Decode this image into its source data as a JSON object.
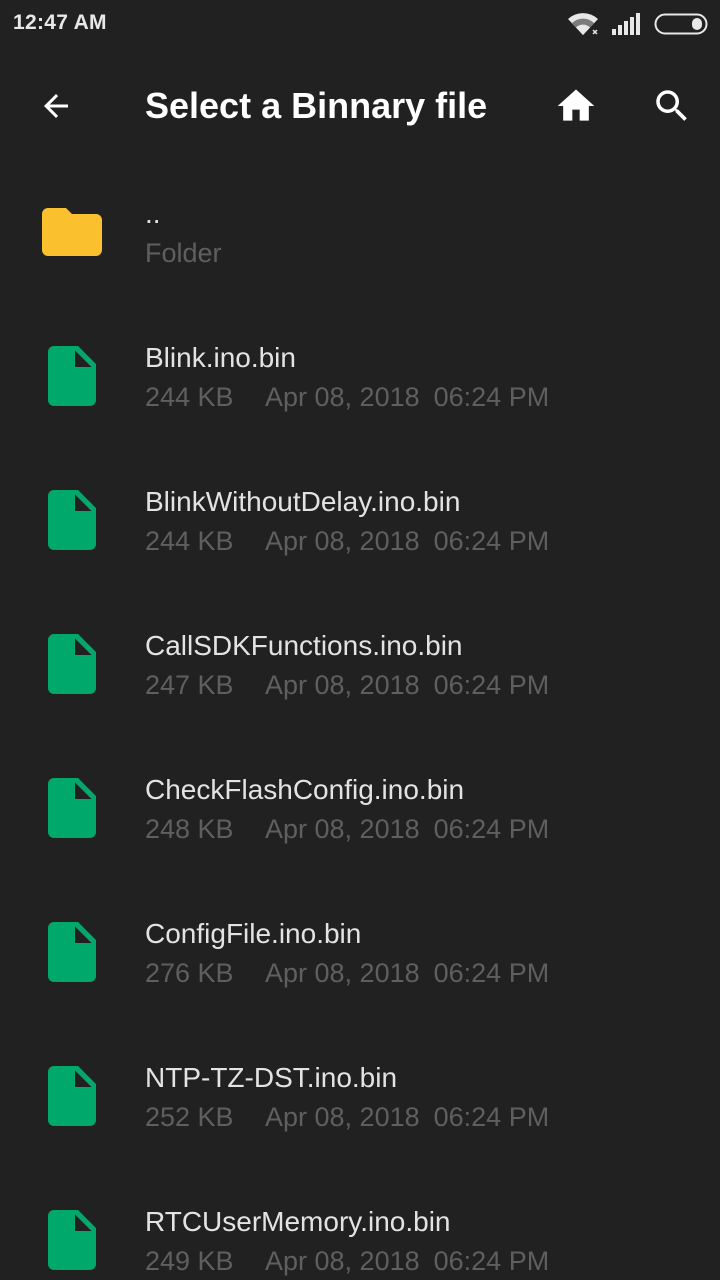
{
  "status_bar": {
    "time": "12:47 AM"
  },
  "app_bar": {
    "title": "Select a Binnary file",
    "back_icon": "arrow-back-icon",
    "home_icon": "home-icon",
    "search_icon": "search-icon"
  },
  "colors": {
    "background": "#212121",
    "folder": "#FBC02D",
    "file": "#00A86B",
    "primary_text": "#E3E3E3",
    "secondary_text": "#5F5F5F"
  },
  "items": [
    {
      "type": "folder",
      "name": "..",
      "subtitle": "Folder"
    },
    {
      "type": "file",
      "name": "Blink.ino.bin",
      "size": "244 KB",
      "date": "Apr 08, 2018",
      "time": "06:24 PM"
    },
    {
      "type": "file",
      "name": "BlinkWithoutDelay.ino.bin",
      "size": "244 KB",
      "date": "Apr 08, 2018",
      "time": "06:24 PM"
    },
    {
      "type": "file",
      "name": "CallSDKFunctions.ino.bin",
      "size": "247 KB",
      "date": "Apr 08, 2018",
      "time": "06:24 PM"
    },
    {
      "type": "file",
      "name": "CheckFlashConfig.ino.bin",
      "size": "248 KB",
      "date": "Apr 08, 2018",
      "time": "06:24 PM"
    },
    {
      "type": "file",
      "name": "ConfigFile.ino.bin",
      "size": "276 KB",
      "date": "Apr 08, 2018",
      "time": "06:24 PM"
    },
    {
      "type": "file",
      "name": "NTP-TZ-DST.ino.bin",
      "size": "252 KB",
      "date": "Apr 08, 2018",
      "time": "06:24 PM"
    },
    {
      "type": "file",
      "name": "RTCUserMemory.ino.bin",
      "size": "249 KB",
      "date": "Apr 08, 2018",
      "time": "06:24 PM"
    }
  ]
}
